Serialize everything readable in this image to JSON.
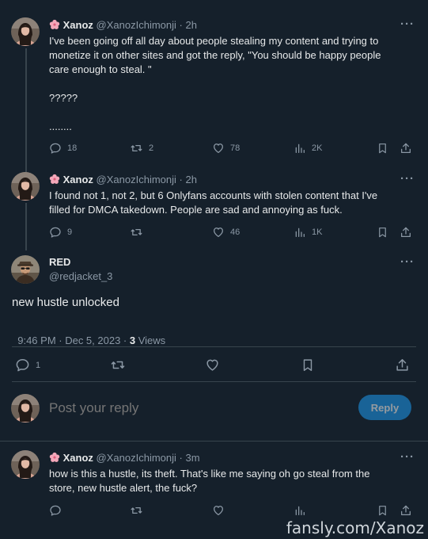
{
  "tweets": [
    {
      "author": "Xanoz",
      "handle": "@XanozIchimonji",
      "time": "2h",
      "lines": [
        "I've been going off all day about people stealing my content and trying to",
        "monetize it on other sites and got the reply, \"You should be happy people",
        "care enough to steal. \"",
        "",
        "?????",
        "",
        "........"
      ],
      "replies": "18",
      "retweets": "2",
      "likes": "78",
      "views": "2K"
    },
    {
      "author": "Xanoz",
      "handle": "@XanozIchimonji",
      "time": "2h",
      "lines": [
        "I found not 1, not 2, but 6 Onlyfans accounts with stolen content that I've",
        "filled for DMCA takedown. People are sad and annoying as fuck."
      ],
      "replies": "9",
      "retweets": "",
      "likes": "46",
      "views": "1K"
    }
  ],
  "focused": {
    "author": "RED",
    "handle": "@redjacket_3",
    "text": "new hustle unlocked",
    "timestamp": "9:46 PM · Dec 5, 2023 · ",
    "views_count": "3",
    "views_label": " Views",
    "replies": "1"
  },
  "composer": {
    "placeholder": "Post your reply",
    "button": "Reply"
  },
  "reply": {
    "author": "Xanoz",
    "handle": "@XanozIchimonji",
    "time": "3m",
    "lines": [
      "how is this a hustle, its theft. That's like me saying oh go steal from the",
      "store, new hustle alert, the fuck?"
    ]
  },
  "separator": "·",
  "more": "···",
  "watermark": "fansly.com/Xanoz",
  "colors": {
    "background": "#15202b",
    "text": "#e7e9ea",
    "muted": "#8b98a5",
    "accent": "#1d9bf0",
    "line": "#38444d",
    "flower": "#f4a7b9"
  },
  "icons": [
    "flower-icon",
    "comment-icon",
    "retweet-icon",
    "heart-icon",
    "views-icon",
    "bookmark-icon",
    "share-icon",
    "more-icon"
  ]
}
